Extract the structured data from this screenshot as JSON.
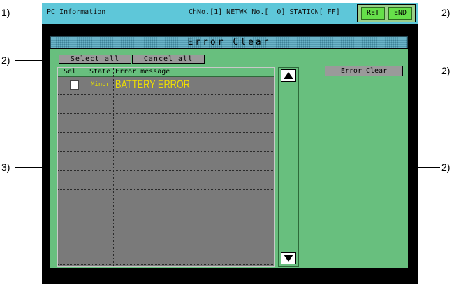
{
  "callouts": {
    "c1": "1)",
    "c2a": "2)",
    "c2b": "2)",
    "c2c": "2)",
    "c2d": "2)",
    "c3": "3)"
  },
  "header": {
    "title": "PC Information",
    "info": "ChNo.[1] NETWK No.[  0] STATION[ FF]",
    "ret_label": "RET",
    "end_label": "END"
  },
  "window_title": "Error Clear",
  "toolbar": {
    "select_all": "Select all",
    "cancel_all": "Cancel all",
    "error_clear": "Error Clear"
  },
  "table": {
    "columns": [
      "Sel",
      "State",
      "Error message"
    ],
    "rows": [
      {
        "checked": false,
        "state": "Minor",
        "message": "BATTERY ERROR"
      }
    ],
    "visible_row_count": 10
  },
  "colors": {
    "header_bg": "#5ec7d9",
    "panel_bg": "#68bf7e",
    "button_green": "#66e04a",
    "message_yellow": "#f0e000"
  },
  "icons": {
    "scroll_up": "triangle-up-icon",
    "scroll_down": "triangle-down-icon"
  }
}
